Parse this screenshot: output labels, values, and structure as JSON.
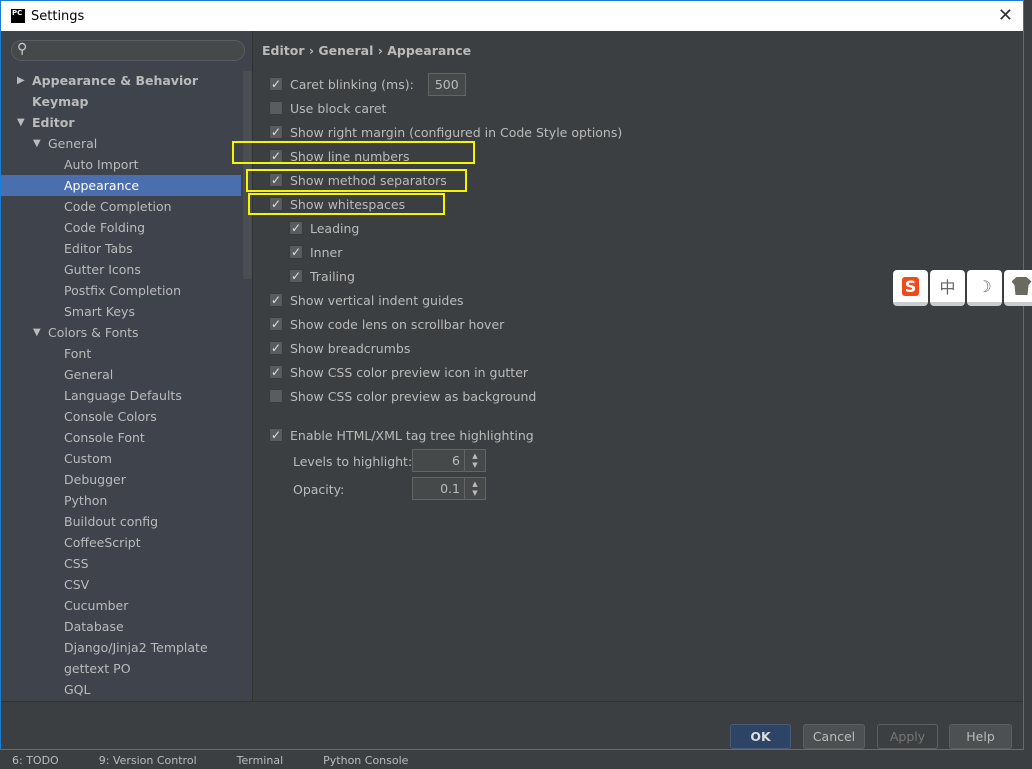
{
  "title": "Settings",
  "logo": "PC",
  "breadcrumb": [
    "Editor",
    "General",
    "Appearance"
  ],
  "tree": [
    {
      "label": "Appearance & Behavior",
      "level": 0,
      "bold": true,
      "arrow": "right"
    },
    {
      "label": "Keymap",
      "level": 0,
      "bold": true
    },
    {
      "label": "Editor",
      "level": 0,
      "bold": true,
      "arrow": "down"
    },
    {
      "label": "General",
      "level": 1,
      "arrow": "down"
    },
    {
      "label": "Auto Import",
      "level": 2
    },
    {
      "label": "Appearance",
      "level": 2,
      "selected": true
    },
    {
      "label": "Code Completion",
      "level": 2
    },
    {
      "label": "Code Folding",
      "level": 2
    },
    {
      "label": "Editor Tabs",
      "level": 2
    },
    {
      "label": "Gutter Icons",
      "level": 2
    },
    {
      "label": "Postfix Completion",
      "level": 2
    },
    {
      "label": "Smart Keys",
      "level": 2
    },
    {
      "label": "Colors & Fonts",
      "level": 1,
      "arrow": "down"
    },
    {
      "label": "Font",
      "level": 2
    },
    {
      "label": "General",
      "level": 2
    },
    {
      "label": "Language Defaults",
      "level": 2
    },
    {
      "label": "Console Colors",
      "level": 2
    },
    {
      "label": "Console Font",
      "level": 2
    },
    {
      "label": "Custom",
      "level": 2
    },
    {
      "label": "Debugger",
      "level": 2
    },
    {
      "label": "Python",
      "level": 2
    },
    {
      "label": "Buildout config",
      "level": 2
    },
    {
      "label": "CoffeeScript",
      "level": 2
    },
    {
      "label": "CSS",
      "level": 2
    },
    {
      "label": "CSV",
      "level": 2
    },
    {
      "label": "Cucumber",
      "level": 2
    },
    {
      "label": "Database",
      "level": 2
    },
    {
      "label": "Django/Jinja2 Template",
      "level": 2
    },
    {
      "label": "gettext PO",
      "level": 2
    },
    {
      "label": "GQL",
      "level": 2
    }
  ],
  "options": [
    {
      "label": "Caret blinking (ms):",
      "checked": true,
      "value": "500"
    },
    {
      "label": "Use block caret",
      "checked": false
    },
    {
      "label": "Show right margin (configured in Code Style options)",
      "checked": true
    },
    {
      "label": "Show line numbers",
      "checked": true,
      "highlight": true
    },
    {
      "label": "Show method separators",
      "checked": true,
      "highlight": true
    },
    {
      "label": "Show whitespaces",
      "checked": true,
      "highlight": true
    },
    {
      "label": "Leading",
      "checked": true,
      "indent": true
    },
    {
      "label": "Inner",
      "checked": true,
      "indent": true
    },
    {
      "label": "Trailing",
      "checked": true,
      "indent": true
    },
    {
      "label": "Show vertical indent guides",
      "checked": true
    },
    {
      "label": "Show code lens on scrollbar hover",
      "checked": true
    },
    {
      "label": "Show breadcrumbs",
      "checked": true
    },
    {
      "label": "Show CSS color preview icon in gutter",
      "checked": true
    },
    {
      "label": "Show CSS color preview as background",
      "checked": false
    }
  ],
  "tag_highlight": {
    "label": "Enable HTML/XML tag tree highlighting",
    "checked": true,
    "levels_label": "Levels to highlight:",
    "levels": "6",
    "opacity_label": "Opacity:",
    "opacity": "0.1"
  },
  "buttons": {
    "ok": "OK",
    "cancel": "Cancel",
    "apply": "Apply",
    "help": "Help"
  },
  "ime": [
    "S",
    "中",
    "☽",
    "👕"
  ],
  "statusbar": [
    "6: TODO",
    "9: Version Control",
    "Terminal",
    "Python Console"
  ],
  "colors": {
    "selection": "#4b6eaf",
    "highlight": "#f5f500",
    "ok": "#2d4466"
  }
}
